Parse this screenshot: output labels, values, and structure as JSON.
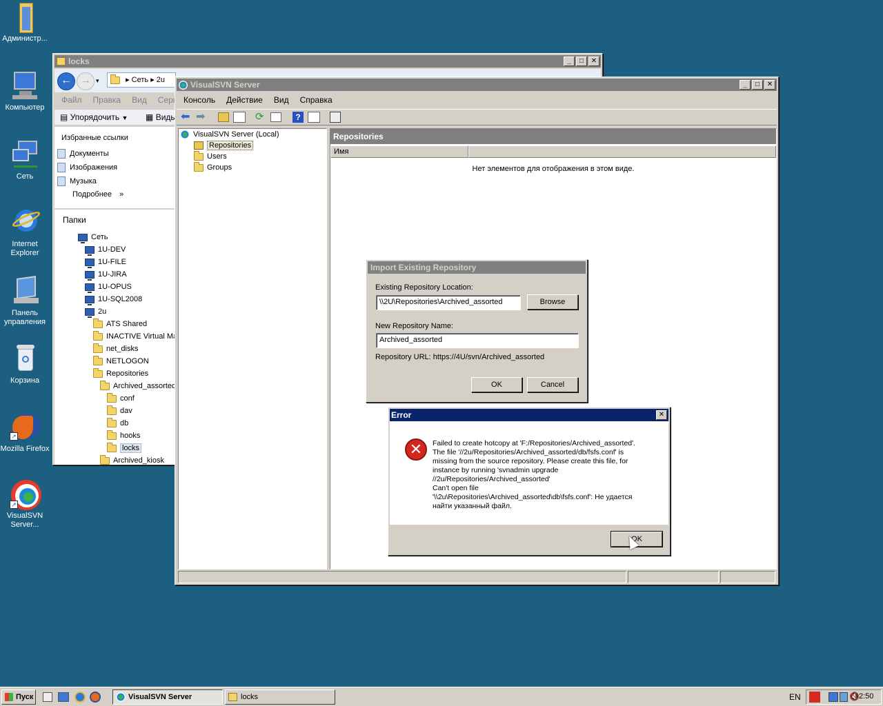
{
  "desktop": {
    "icons": [
      {
        "label": "Администр..."
      },
      {
        "label": "Компьютер"
      },
      {
        "label": "Сеть"
      },
      {
        "label": "Internet Explorer"
      },
      {
        "label": "Панель управления"
      },
      {
        "label": "Корзина"
      },
      {
        "label": "Mozilla Firefox"
      },
      {
        "label": "VisualSVN Server..."
      }
    ]
  },
  "explorer": {
    "title": "locks",
    "address_path": [
      "Сеть",
      "2u"
    ],
    "menu": [
      "Файл",
      "Правка",
      "Вид",
      "Сервис"
    ],
    "toolbar": {
      "organize": "Упорядочить",
      "views": "Виды"
    },
    "favorites_header": "Избранные ссылки",
    "favorites": [
      "Документы",
      "Изображения",
      "Музыка"
    ],
    "more": "Подробнее",
    "more_arrow": "»",
    "folders_header": "Папки",
    "tree": [
      {
        "label": "Сеть",
        "type": "network",
        "indent": 0
      },
      {
        "label": "1U-DEV",
        "type": "pc",
        "indent": 1
      },
      {
        "label": "1U-FILE",
        "type": "pc",
        "indent": 1
      },
      {
        "label": "1U-JIRA",
        "type": "pc",
        "indent": 1
      },
      {
        "label": "1U-OPUS",
        "type": "pc",
        "indent": 1
      },
      {
        "label": "1U-SQL2008",
        "type": "pc",
        "indent": 1
      },
      {
        "label": "2u",
        "type": "pc",
        "indent": 1
      },
      {
        "label": "ATS Shared",
        "type": "folder",
        "indent": 2
      },
      {
        "label": "INACTIVE Virtual Mac",
        "type": "folder",
        "indent": 2
      },
      {
        "label": "net_disks",
        "type": "folder",
        "indent": 2
      },
      {
        "label": "NETLOGON",
        "type": "folder",
        "indent": 2
      },
      {
        "label": "Repositories",
        "type": "folder",
        "indent": 2
      },
      {
        "label": "Archived_assorted",
        "type": "folder",
        "indent": 3
      },
      {
        "label": "conf",
        "type": "folder",
        "indent": 4
      },
      {
        "label": "dav",
        "type": "folder",
        "indent": 4
      },
      {
        "label": "db",
        "type": "folder",
        "indent": 4
      },
      {
        "label": "hooks",
        "type": "folder",
        "indent": 4
      },
      {
        "label": "locks",
        "type": "folder",
        "indent": 4,
        "selected": true
      },
      {
        "label": "Archived_kiosk",
        "type": "folder",
        "indent": 3
      }
    ]
  },
  "svn": {
    "title": "VisualSVN Server",
    "menu": [
      "Консоль",
      "Действие",
      "Вид",
      "Справка"
    ],
    "tree": {
      "root": "VisualSVN Server (Local)",
      "items": [
        "Repositories",
        "Users",
        "Groups"
      ]
    },
    "panel_header": "Repositories",
    "column_name": "Имя",
    "empty_message": "Нет элементов для отображения в этом виде."
  },
  "import_dialog": {
    "title": "Import Existing Repository",
    "location_label": "Existing Repository Location:",
    "location_value": "\\\\2U\\Repositories\\Archived_assorted",
    "browse_label": "Browse",
    "name_label": "New Repository Name:",
    "name_value": "Archived_assorted",
    "url_label": "Repository URL:",
    "url_value": "https://4U/svn/Archived_assorted",
    "ok_label": "OK",
    "cancel_label": "Cancel"
  },
  "error_dialog": {
    "title": "Error",
    "close": "✕",
    "message_lines": [
      "Failed to create hotcopy at 'F:/Repositories/Archived_assorted'.",
      "The file '//2u/Repositories/Archived_assorted/db/fsfs.conf' is",
      "missing from the source repository. Please create this file, for",
      "instance by running 'svnadmin upgrade",
      "//2u/Repositories/Archived_assorted'",
      "Can't open file",
      "'\\\\2u\\Repositories\\Archived_assorted\\db\\fsfs.conf': Не удается",
      "найти указанный файл."
    ],
    "ok_label": "OK"
  },
  "taskbar": {
    "start_label": "Пуск",
    "tasks": [
      {
        "label": "VisualSVN Server",
        "active": true
      },
      {
        "label": "locks",
        "active": false
      }
    ],
    "language": "EN",
    "clock": "2:50"
  }
}
